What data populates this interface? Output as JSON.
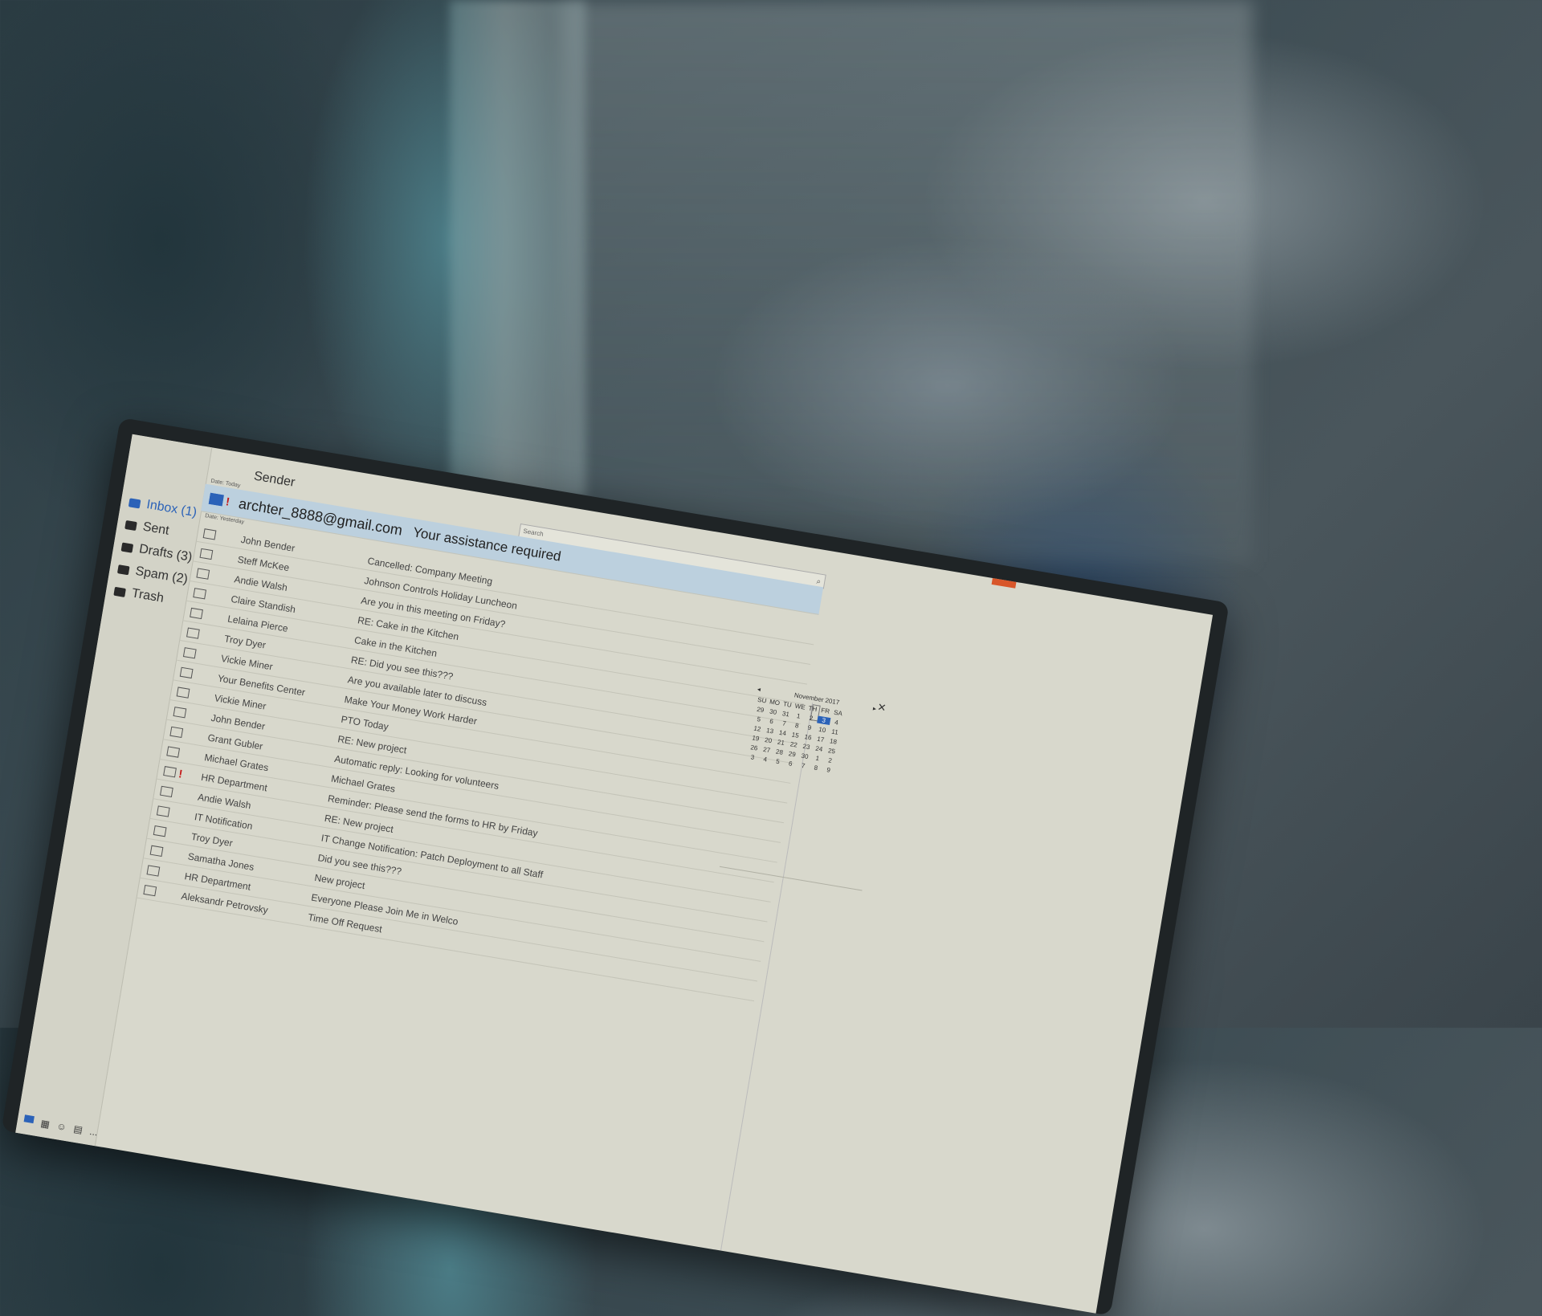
{
  "sidebar": {
    "folders": [
      {
        "label": "Inbox (1)",
        "active": true
      },
      {
        "label": "Sent"
      },
      {
        "label": "Drafts (3)"
      },
      {
        "label": "Spam (2)"
      },
      {
        "label": "Trash"
      }
    ],
    "bottom_icons": [
      "mail-icon",
      "calendar-icon",
      "people-icon",
      "tasks-icon",
      "more-icon"
    ],
    "more_label": "..."
  },
  "list": {
    "sender_header": "Sender",
    "subject_header": "Subject",
    "search_placeholder": "Search",
    "group_today": "Date: Today",
    "group_yesterday": "Date: Yesterday",
    "highlighted": {
      "sender": "archter_8888@gmail.com",
      "subject": "Your assistance required",
      "important": true
    },
    "rows": [
      {
        "sender": "John Bender",
        "subject": "Cancelled: Company Meeting"
      },
      {
        "sender": "Steff McKee",
        "subject": "Johnson Controls Holiday Luncheon"
      },
      {
        "sender": "Andie Walsh",
        "subject": "Are you in this meeting on Friday?"
      },
      {
        "sender": "Claire Standish",
        "subject": "RE: Cake in the Kitchen"
      },
      {
        "sender": "Lelaina Pierce",
        "subject": "Cake in the Kitchen"
      },
      {
        "sender": "Troy Dyer",
        "subject": "RE: Did you see this???"
      },
      {
        "sender": "Vickie Miner",
        "subject": "Are you available later to discuss"
      },
      {
        "sender": "Your Benefits Center",
        "subject": "Make Your Money Work Harder"
      },
      {
        "sender": "Vickie Miner",
        "subject": "PTO Today"
      },
      {
        "sender": "John Bender",
        "subject": "RE: New project"
      },
      {
        "sender": "Grant Gubler",
        "subject": "Automatic reply: Looking for volunteers"
      },
      {
        "sender": "Michael Grates",
        "subject": "Michael Grates"
      },
      {
        "sender": "HR Department",
        "subject": "Reminder: Please send the forms to HR by Friday",
        "important": true
      },
      {
        "sender": "Andie Walsh",
        "subject": "RE: New project"
      },
      {
        "sender": "IT Notification",
        "subject": "IT Change Notification: Patch Deployment to all Staff"
      },
      {
        "sender": "Troy Dyer",
        "subject": "Did you see this???"
      },
      {
        "sender": "Samatha Jones",
        "subject": "New project"
      },
      {
        "sender": "HR Department",
        "subject": "Everyone Please Join Me in Welco"
      },
      {
        "sender": "Aleksandr Petrovsky",
        "subject": "Time Off Request"
      }
    ]
  },
  "calendar": {
    "title": "November 2017",
    "prev": "◂",
    "next": "▸",
    "close": "✕",
    "weekdays": [
      "SU",
      "MO",
      "TU",
      "WE",
      "TH",
      "FR",
      "SA"
    ],
    "days": [
      "29",
      "30",
      "31",
      "1",
      "2",
      "3",
      "4",
      "5",
      "6",
      "7",
      "8",
      "9",
      "10",
      "11",
      "12",
      "13",
      "14",
      "15",
      "16",
      "17",
      "18",
      "19",
      "20",
      "21",
      "22",
      "23",
      "24",
      "25",
      "26",
      "27",
      "28",
      "29",
      "30",
      "1",
      "2",
      "3",
      "4",
      "5",
      "6",
      "7",
      "8",
      "9"
    ],
    "selected_day": "3",
    "accent_color": "#2b62b8"
  }
}
